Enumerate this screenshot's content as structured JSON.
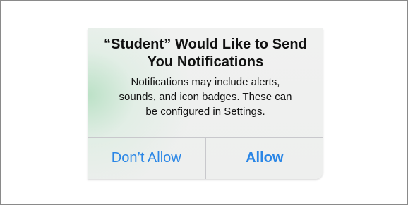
{
  "alert": {
    "title_line1": "“Student” Would Like to Send",
    "title_line2": "You Notifications",
    "message_line1": "Notifications may include alerts,",
    "message_line2": "sounds, and icon badges. These can",
    "message_line3": "be configured in Settings.",
    "buttons": {
      "deny_label": "Don’t Allow",
      "allow_label": "Allow"
    }
  },
  "colors": {
    "button_text": "#2a86e6",
    "text": "#111111",
    "divider": "#c8c8cc"
  }
}
